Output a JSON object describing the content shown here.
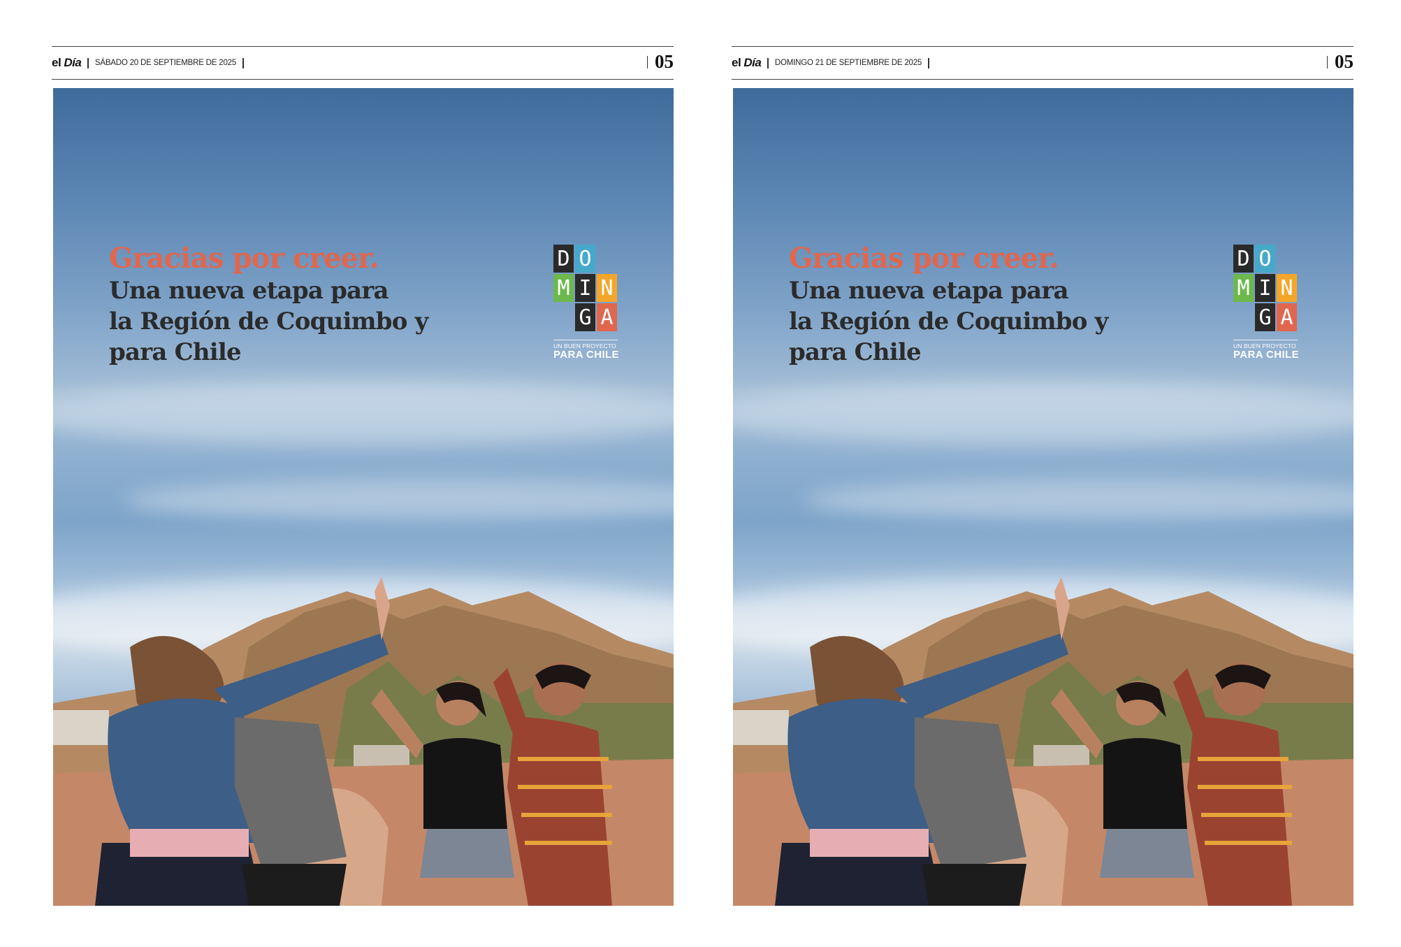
{
  "pages": [
    {
      "masthead": {
        "plain": "el ",
        "italic": "Día"
      },
      "date": "SÁBADO 20 DE SEPTIEMBRE DE 2025",
      "page_number": "05"
    },
    {
      "masthead": {
        "plain": "el ",
        "italic": "Día"
      },
      "date": "DOMINGO 21 DE SEPTIEMBRE DE 2025",
      "page_number": "05"
    }
  ],
  "ad": {
    "headline_accent": "Gracias por creer.",
    "headline_lines": [
      "Una nueva etapa para",
      "la Región de Coquimbo y",
      "para Chile"
    ],
    "logo": {
      "tiles": [
        {
          "letter": "D",
          "color": "#2a2a2a"
        },
        {
          "letter": "O",
          "color": "#47a9c9"
        },
        {
          "letter": "",
          "color": "transparent"
        },
        {
          "letter": "M",
          "color": "#6cb84d"
        },
        {
          "letter": "I",
          "color": "#2a2a2a"
        },
        {
          "letter": "N",
          "color": "#f4a62a"
        },
        {
          "letter": "",
          "color": "transparent"
        },
        {
          "letter": "G",
          "color": "#2a2a2a"
        },
        {
          "letter": "A",
          "color": "#e0674e"
        }
      ],
      "tagline_small": "UN BUEN PROYECTO",
      "tagline_big": "PARA CHILE"
    },
    "colors": {
      "accent": "#e0674e",
      "headline": "#2b2b2b"
    }
  }
}
